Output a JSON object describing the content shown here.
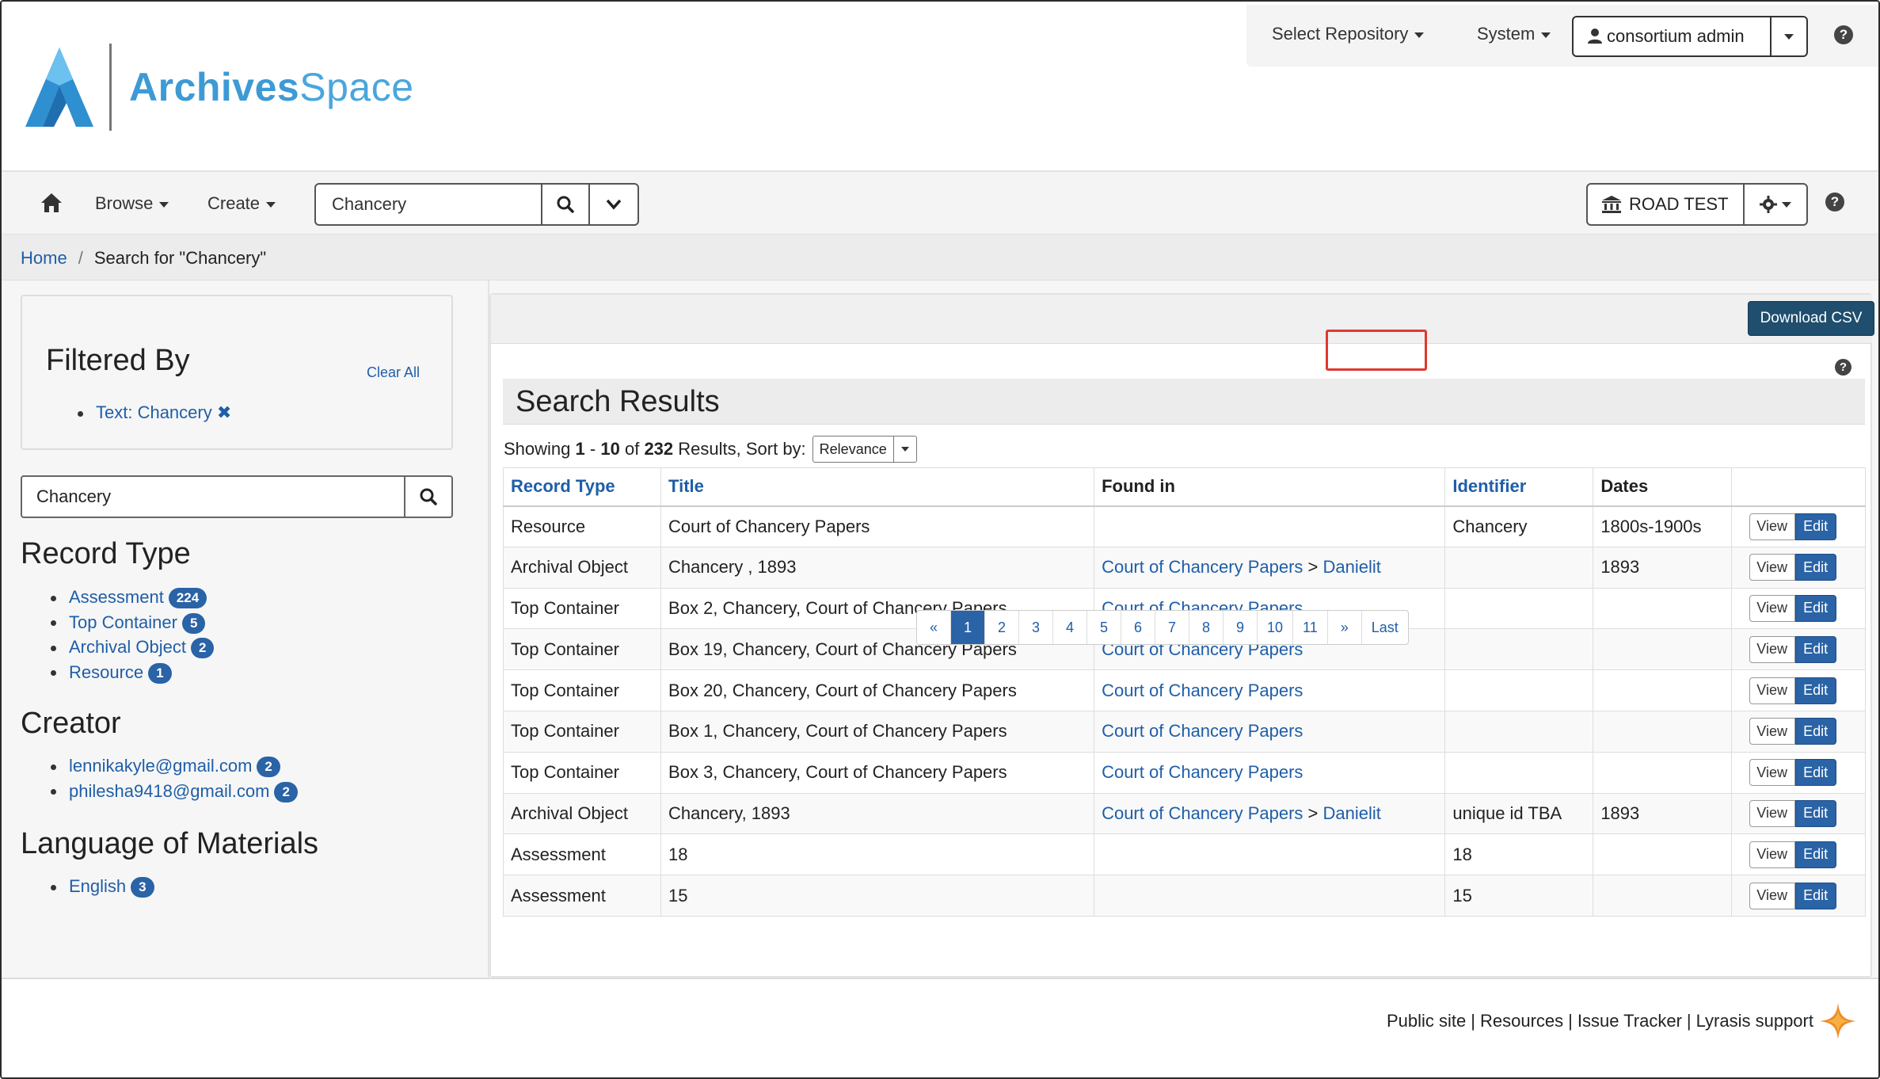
{
  "app": {
    "logo_text_bold": "Archives",
    "logo_text_light": "Space"
  },
  "topbar": {
    "select_repository": "Select Repository",
    "system": "System",
    "user": "consortium admin",
    "help": "?"
  },
  "navbar": {
    "browse": "Browse",
    "create": "Create",
    "search_value": "Chancery",
    "repository": "ROAD TEST",
    "help": "?"
  },
  "breadcrumb": {
    "home": "Home",
    "current": "Search for \"Chancery\""
  },
  "sidebar": {
    "filtered_by": "Filtered By",
    "clear_all": "Clear All",
    "active_filter": "Text: Chancery",
    "search_value": "Chancery",
    "facets": [
      {
        "title": "Record Type",
        "items": [
          {
            "label": "Assessment",
            "count": "224"
          },
          {
            "label": "Top Container",
            "count": "5"
          },
          {
            "label": "Archival Object",
            "count": "2"
          },
          {
            "label": "Resource",
            "count": "1"
          }
        ]
      },
      {
        "title": "Creator",
        "items": [
          {
            "label": "lennikakyle@gmail.com",
            "count": "2"
          },
          {
            "label": "philesha9418@gmail.com",
            "count": "2"
          }
        ]
      },
      {
        "title": "Language of Materials",
        "items": [
          {
            "label": "English",
            "count": "3"
          }
        ]
      }
    ]
  },
  "main": {
    "download_csv": "Download CSV",
    "help": "?",
    "title": "Search Results",
    "summary": {
      "showing": "Showing",
      "from": "1",
      "dash": "-",
      "to": "10",
      "of": "of",
      "total": "232",
      "results_sort": "Results, Sort by:",
      "sort_value": "Relevance"
    },
    "columns": [
      "Record Type",
      "Title",
      "Found in",
      "Identifier",
      "Dates",
      ""
    ],
    "view_label": "View",
    "edit_label": "Edit",
    "rows": [
      {
        "type": "Resource",
        "title": "Court of Chancery Papers",
        "found_in": "",
        "found_in_sub": "",
        "identifier": "Chancery",
        "dates": "1800s-1900s"
      },
      {
        "type": "Archival Object",
        "title": "Chancery , 1893",
        "found_in": "Court of Chancery Papers",
        "found_in_sub": "Danielit",
        "identifier": "",
        "dates": "1893"
      },
      {
        "type": "Top Container",
        "title": "Box 2, Chancery, Court of Chancery Papers",
        "found_in": "Court of Chancery Papers",
        "found_in_sub": "",
        "identifier": "",
        "dates": ""
      },
      {
        "type": "Top Container",
        "title": "Box 19, Chancery, Court of Chancery Papers",
        "found_in": "Court of Chancery Papers",
        "found_in_sub": "",
        "identifier": "",
        "dates": ""
      },
      {
        "type": "Top Container",
        "title": "Box 20, Chancery, Court of Chancery Papers",
        "found_in": "Court of Chancery Papers",
        "found_in_sub": "",
        "identifier": "",
        "dates": ""
      },
      {
        "type": "Top Container",
        "title": "Box 1, Chancery, Court of Chancery Papers",
        "found_in": "Court of Chancery Papers",
        "found_in_sub": "",
        "identifier": "",
        "dates": ""
      },
      {
        "type": "Top Container",
        "title": "Box 3, Chancery, Court of Chancery Papers",
        "found_in": "Court of Chancery Papers",
        "found_in_sub": "",
        "identifier": "",
        "dates": ""
      },
      {
        "type": "Archival Object",
        "title": "Chancery, 1893",
        "found_in": "Court of Chancery Papers",
        "found_in_sub": "Danielit",
        "identifier": "unique id TBA",
        "dates": "1893"
      },
      {
        "type": "Assessment",
        "title": "18",
        "found_in": "",
        "found_in_sub": "",
        "identifier": "18",
        "dates": ""
      },
      {
        "type": "Assessment",
        "title": "15",
        "found_in": "",
        "found_in_sub": "",
        "identifier": "15",
        "dates": ""
      }
    ],
    "pagination": [
      "«",
      "1",
      "2",
      "3",
      "4",
      "5",
      "6",
      "7",
      "8",
      "9",
      "10",
      "11",
      "»",
      "Last"
    ],
    "active_page": "1"
  },
  "footer": {
    "links": [
      "Public site",
      "Resources",
      "Issue Tracker",
      "Lyrasis support"
    ],
    "separator": "|"
  },
  "colors": {
    "link": "#1f5ea8",
    "primary": "#2a63a6",
    "csv_button": "#1f4e6e",
    "highlight": "#e0392e",
    "logo": "#4aa6dd"
  }
}
